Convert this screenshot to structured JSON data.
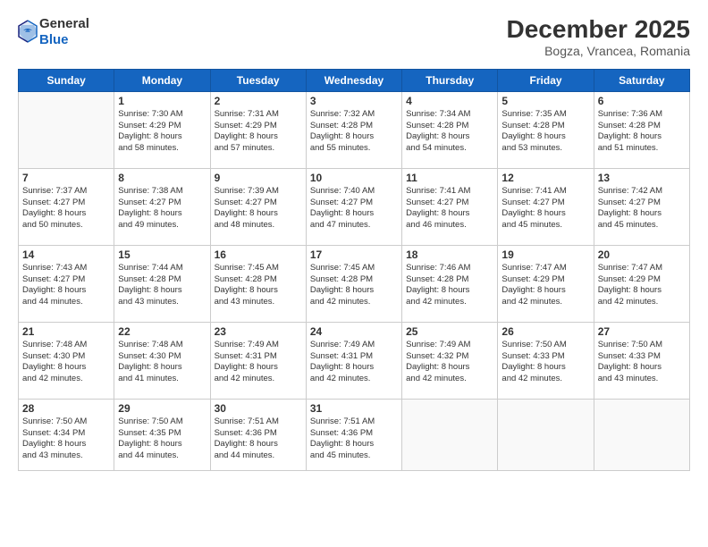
{
  "header": {
    "logo_line1": "General",
    "logo_line2": "Blue",
    "title": "December 2025",
    "subtitle": "Bogza, Vrancea, Romania"
  },
  "weekdays": [
    "Sunday",
    "Monday",
    "Tuesday",
    "Wednesday",
    "Thursday",
    "Friday",
    "Saturday"
  ],
  "weeks": [
    [
      {
        "day": "",
        "info": ""
      },
      {
        "day": "1",
        "info": "Sunrise: 7:30 AM\nSunset: 4:29 PM\nDaylight: 8 hours\nand 58 minutes."
      },
      {
        "day": "2",
        "info": "Sunrise: 7:31 AM\nSunset: 4:29 PM\nDaylight: 8 hours\nand 57 minutes."
      },
      {
        "day": "3",
        "info": "Sunrise: 7:32 AM\nSunset: 4:28 PM\nDaylight: 8 hours\nand 55 minutes."
      },
      {
        "day": "4",
        "info": "Sunrise: 7:34 AM\nSunset: 4:28 PM\nDaylight: 8 hours\nand 54 minutes."
      },
      {
        "day": "5",
        "info": "Sunrise: 7:35 AM\nSunset: 4:28 PM\nDaylight: 8 hours\nand 53 minutes."
      },
      {
        "day": "6",
        "info": "Sunrise: 7:36 AM\nSunset: 4:28 PM\nDaylight: 8 hours\nand 51 minutes."
      }
    ],
    [
      {
        "day": "7",
        "info": "Sunrise: 7:37 AM\nSunset: 4:27 PM\nDaylight: 8 hours\nand 50 minutes."
      },
      {
        "day": "8",
        "info": "Sunrise: 7:38 AM\nSunset: 4:27 PM\nDaylight: 8 hours\nand 49 minutes."
      },
      {
        "day": "9",
        "info": "Sunrise: 7:39 AM\nSunset: 4:27 PM\nDaylight: 8 hours\nand 48 minutes."
      },
      {
        "day": "10",
        "info": "Sunrise: 7:40 AM\nSunset: 4:27 PM\nDaylight: 8 hours\nand 47 minutes."
      },
      {
        "day": "11",
        "info": "Sunrise: 7:41 AM\nSunset: 4:27 PM\nDaylight: 8 hours\nand 46 minutes."
      },
      {
        "day": "12",
        "info": "Sunrise: 7:41 AM\nSunset: 4:27 PM\nDaylight: 8 hours\nand 45 minutes."
      },
      {
        "day": "13",
        "info": "Sunrise: 7:42 AM\nSunset: 4:27 PM\nDaylight: 8 hours\nand 45 minutes."
      }
    ],
    [
      {
        "day": "14",
        "info": "Sunrise: 7:43 AM\nSunset: 4:27 PM\nDaylight: 8 hours\nand 44 minutes."
      },
      {
        "day": "15",
        "info": "Sunrise: 7:44 AM\nSunset: 4:28 PM\nDaylight: 8 hours\nand 43 minutes."
      },
      {
        "day": "16",
        "info": "Sunrise: 7:45 AM\nSunset: 4:28 PM\nDaylight: 8 hours\nand 43 minutes."
      },
      {
        "day": "17",
        "info": "Sunrise: 7:45 AM\nSunset: 4:28 PM\nDaylight: 8 hours\nand 42 minutes."
      },
      {
        "day": "18",
        "info": "Sunrise: 7:46 AM\nSunset: 4:28 PM\nDaylight: 8 hours\nand 42 minutes."
      },
      {
        "day": "19",
        "info": "Sunrise: 7:47 AM\nSunset: 4:29 PM\nDaylight: 8 hours\nand 42 minutes."
      },
      {
        "day": "20",
        "info": "Sunrise: 7:47 AM\nSunset: 4:29 PM\nDaylight: 8 hours\nand 42 minutes."
      }
    ],
    [
      {
        "day": "21",
        "info": "Sunrise: 7:48 AM\nSunset: 4:30 PM\nDaylight: 8 hours\nand 42 minutes."
      },
      {
        "day": "22",
        "info": "Sunrise: 7:48 AM\nSunset: 4:30 PM\nDaylight: 8 hours\nand 41 minutes."
      },
      {
        "day": "23",
        "info": "Sunrise: 7:49 AM\nSunset: 4:31 PM\nDaylight: 8 hours\nand 42 minutes."
      },
      {
        "day": "24",
        "info": "Sunrise: 7:49 AM\nSunset: 4:31 PM\nDaylight: 8 hours\nand 42 minutes."
      },
      {
        "day": "25",
        "info": "Sunrise: 7:49 AM\nSunset: 4:32 PM\nDaylight: 8 hours\nand 42 minutes."
      },
      {
        "day": "26",
        "info": "Sunrise: 7:50 AM\nSunset: 4:33 PM\nDaylight: 8 hours\nand 42 minutes."
      },
      {
        "day": "27",
        "info": "Sunrise: 7:50 AM\nSunset: 4:33 PM\nDaylight: 8 hours\nand 43 minutes."
      }
    ],
    [
      {
        "day": "28",
        "info": "Sunrise: 7:50 AM\nSunset: 4:34 PM\nDaylight: 8 hours\nand 43 minutes."
      },
      {
        "day": "29",
        "info": "Sunrise: 7:50 AM\nSunset: 4:35 PM\nDaylight: 8 hours\nand 44 minutes."
      },
      {
        "day": "30",
        "info": "Sunrise: 7:51 AM\nSunset: 4:36 PM\nDaylight: 8 hours\nand 44 minutes."
      },
      {
        "day": "31",
        "info": "Sunrise: 7:51 AM\nSunset: 4:36 PM\nDaylight: 8 hours\nand 45 minutes."
      },
      {
        "day": "",
        "info": ""
      },
      {
        "day": "",
        "info": ""
      },
      {
        "day": "",
        "info": ""
      }
    ]
  ]
}
